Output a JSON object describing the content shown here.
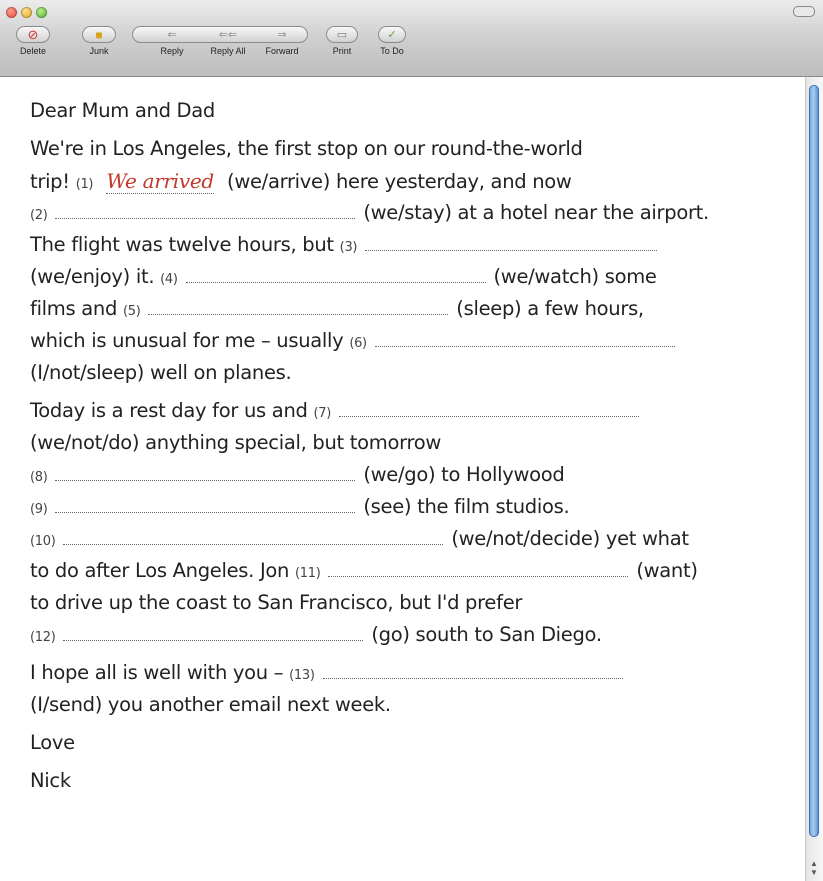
{
  "toolbar": {
    "delete": "Delete",
    "junk": "Junk",
    "reply": "Reply",
    "reply_all": "Reply All",
    "forward": "Forward",
    "print": "Print",
    "todo": "To Do"
  },
  "letter": {
    "greeting": "Dear Mum and Dad",
    "p1_l1": "We're in Los Angeles, the first stop on our round-the-world",
    "p1_l2_a": "trip!",
    "n1": "(1)",
    "answer1": "We arrived",
    "p1_l2_b": "(we/arrive) here yesterday, and now",
    "n2": "(2)",
    "p1_l3": "(we/stay) at a hotel near the airport.",
    "p1_l4": "The flight was twelve hours, but",
    "n3": "(3)",
    "p1_l5_a": "(we/enjoy) it.",
    "n4": "(4)",
    "p1_l5_b": "(we/watch) some",
    "p1_l6_a": "films and",
    "n5": "(5)",
    "p1_l6_b": "(sleep) a few hours,",
    "p1_l7": "which is unusual for me – usually",
    "n6": "(6)",
    "p1_l8": "(I/not/sleep) well on planes.",
    "p2_l1": "Today is a rest day for us and",
    "n7": "(7)",
    "p2_l2": "(we/not/do) anything special, but tomorrow",
    "n8": "(8)",
    "p2_l3": "(we/go) to Hollywood",
    "n9": "(9)",
    "p2_l4": "(see) the film studios.",
    "n10": "(10)",
    "p2_l5": "(we/not/decide) yet what",
    "p2_l6_a": "to do after Los Angeles. Jon",
    "n11": "(11)",
    "p2_l6_b": "(want)",
    "p2_l7": "to drive up the coast to San Francisco, but I'd prefer",
    "n12": "(12)",
    "p2_l8": "(go) south to San Diego.",
    "p3_l1": "I hope all is well with you –",
    "n13": "(13)",
    "p3_l2": "(I/send) you another email next week.",
    "closing": "Love",
    "signature": "Nick"
  }
}
